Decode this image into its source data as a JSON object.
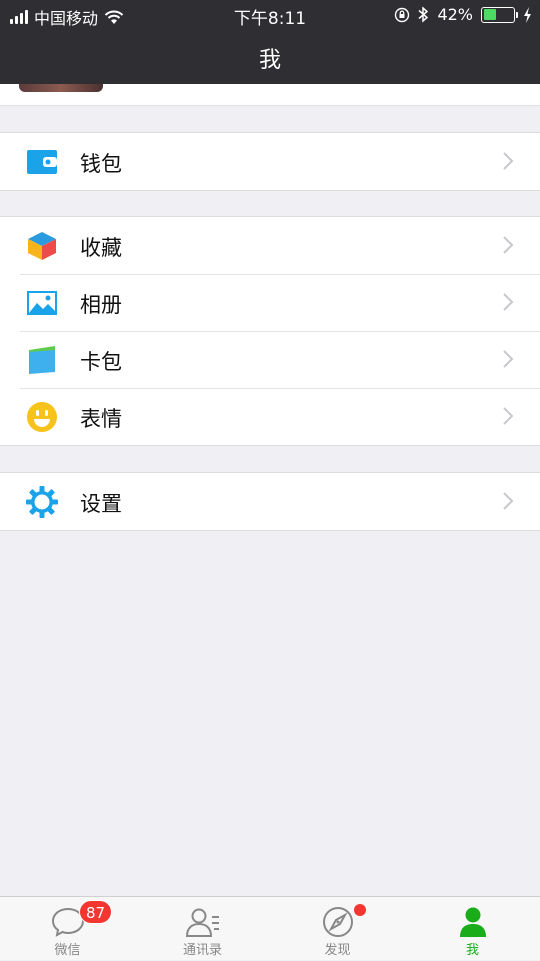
{
  "status_bar": {
    "carrier": "中国移动",
    "time": "下午8:11",
    "battery": "42%",
    "battery_level": 0.42
  },
  "nav": {
    "title": "我"
  },
  "menu": {
    "wallet": {
      "label": "钱包",
      "icon": "wallet-icon"
    },
    "favorites": {
      "label": "收藏",
      "icon": "favorites-cube-icon"
    },
    "album": {
      "label": "相册",
      "icon": "album-icon"
    },
    "cards": {
      "label": "卡包",
      "icon": "card-wallet-icon"
    },
    "stickers": {
      "label": "表情",
      "icon": "smiley-icon"
    },
    "settings": {
      "label": "设置",
      "icon": "gear-icon"
    }
  },
  "tabbar": {
    "chats": {
      "label": "微信",
      "badge": "87"
    },
    "contacts": {
      "label": "通讯录"
    },
    "discover": {
      "label": "发现"
    },
    "me": {
      "label": "我"
    }
  },
  "colors": {
    "nav_bg": "#2e2e33",
    "accent_green": "#1aad19",
    "badge_red": "#f43530",
    "icon_blue": "#1aa3e8",
    "icon_yellow": "#f7c21b"
  }
}
